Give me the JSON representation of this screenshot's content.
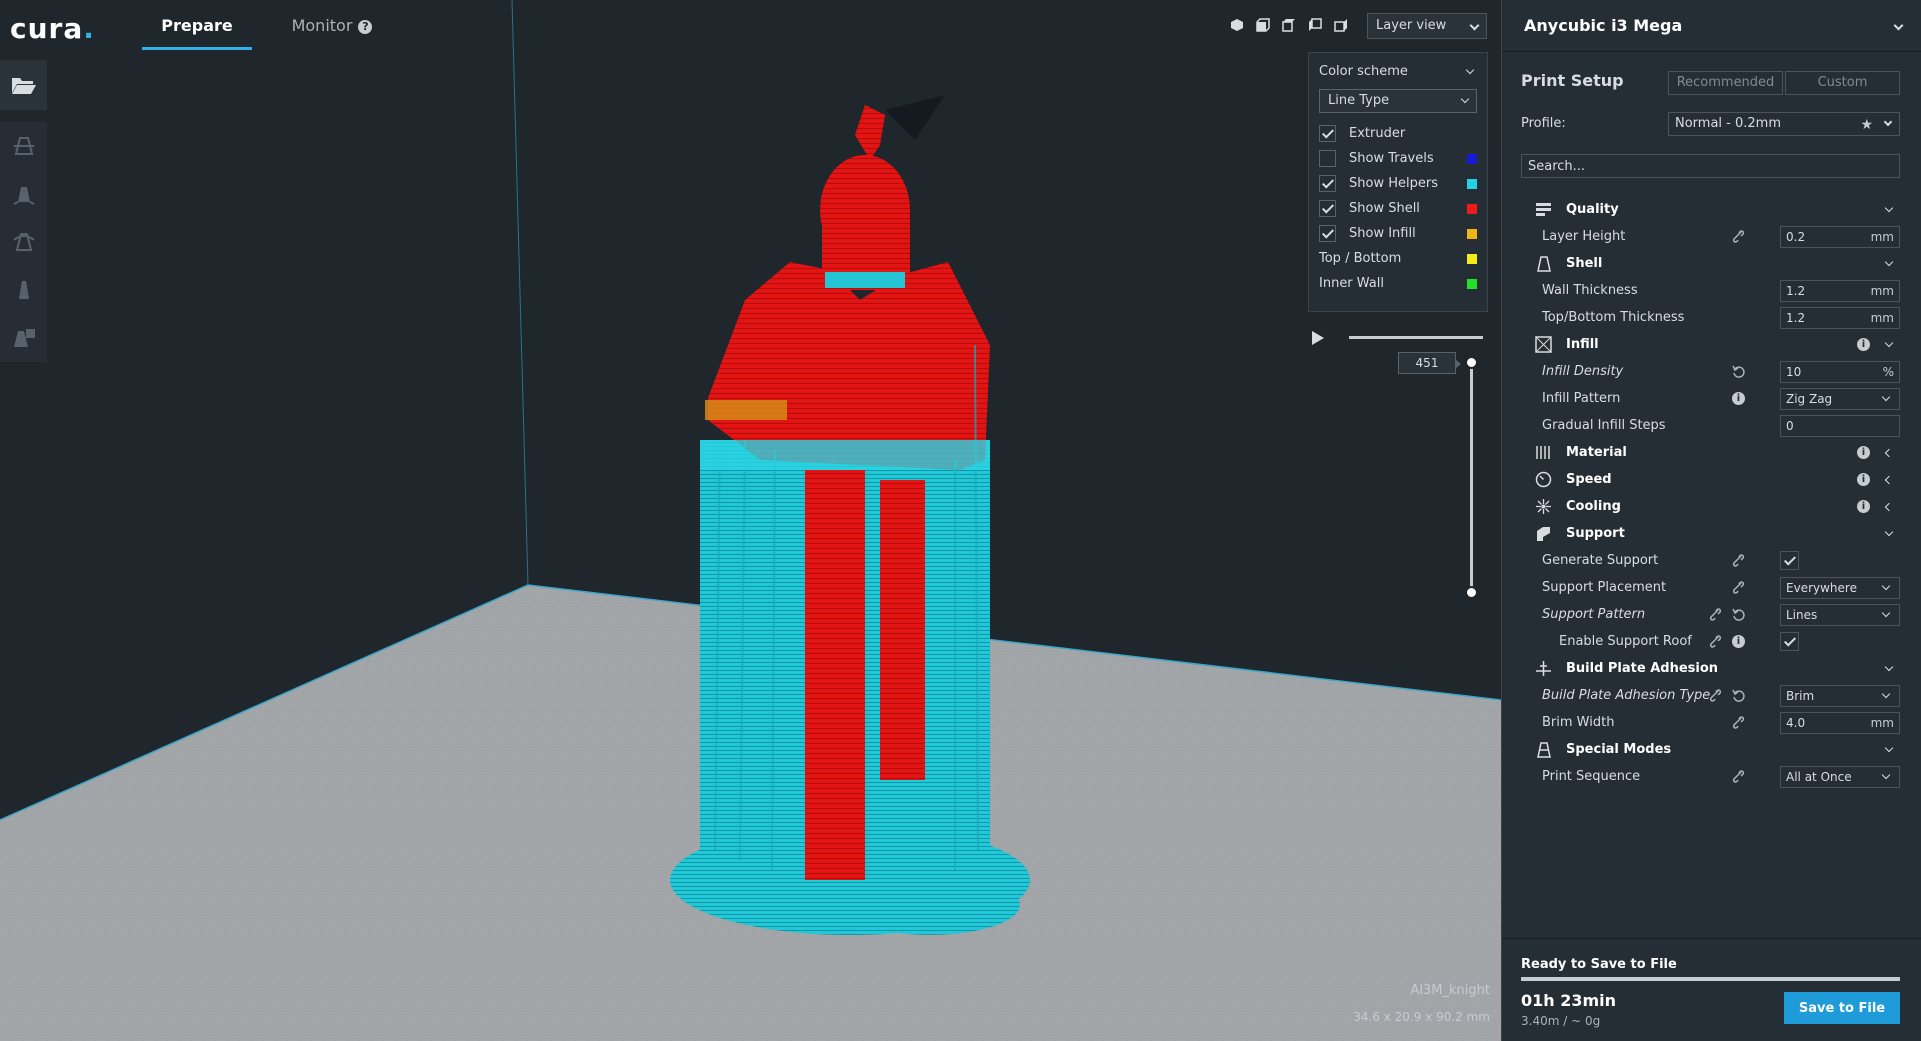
{
  "app": {
    "logo": "cura",
    "tabs": {
      "prepare": "Prepare",
      "monitor": "Monitor"
    }
  },
  "viewport": {
    "view_mode": "Layer view",
    "view_icons": [
      "3d-view-icon",
      "front-view-icon",
      "top-view-icon",
      "left-view-icon",
      "right-view-icon"
    ],
    "model_name": "AI3M_knight",
    "model_dims": "34.6 x 20.9 x 90.2 mm"
  },
  "color_scheme": {
    "title": "Color scheme",
    "selected": "Line Type",
    "items": [
      {
        "label": "Extruder",
        "checkbox": true,
        "checked": true,
        "color": ""
      },
      {
        "label": "Show Travels",
        "checkbox": true,
        "checked": false,
        "color": "#1a1ad6"
      },
      {
        "label": "Show Helpers",
        "checkbox": true,
        "checked": true,
        "color": "#22d3e6"
      },
      {
        "label": "Show Shell",
        "checkbox": true,
        "checked": true,
        "color": "#ee1b1b"
      },
      {
        "label": "Show Infill",
        "checkbox": true,
        "checked": true,
        "color": "#f2b515"
      },
      {
        "label": "Top / Bottom",
        "checkbox": false,
        "checked": false,
        "color": "#f3ec18"
      },
      {
        "label": "Inner Wall",
        "checkbox": false,
        "checked": false,
        "color": "#25e02a"
      }
    ]
  },
  "layer": {
    "current": "451",
    "top_level": 1.0,
    "bottom_level": 0.0
  },
  "sidebar": {
    "machine": "Anycubic i3 Mega",
    "print_setup": "Print Setup",
    "mode_tabs": [
      "Recommended",
      "Custom"
    ],
    "profile_label": "Profile:",
    "profile_value": "Normal - 0.2mm",
    "search_placeholder": "Search...",
    "settings": {
      "quality": "Quality",
      "layer_height": {
        "label": "Layer Height",
        "value": "0.2",
        "unit": "mm"
      },
      "shell": "Shell",
      "wall_thickness": {
        "label": "Wall Thickness",
        "value": "1.2",
        "unit": "mm"
      },
      "top_bottom_thickness": {
        "label": "Top/Bottom Thickness",
        "value": "1.2",
        "unit": "mm"
      },
      "infill": "Infill",
      "infill_density": {
        "label": "Infill Density",
        "value": "10",
        "unit": "%"
      },
      "infill_pattern": {
        "label": "Infill Pattern",
        "value": "Zig Zag"
      },
      "gradual_infill": {
        "label": "Gradual Infill Steps",
        "value": "0"
      },
      "material": "Material",
      "speed": "Speed",
      "cooling": "Cooling",
      "support": "Support",
      "generate_support": {
        "label": "Generate Support"
      },
      "support_placement": {
        "label": "Support Placement",
        "value": "Everywhere"
      },
      "support_pattern": {
        "label": "Support Pattern",
        "value": "Lines"
      },
      "support_roof": {
        "label": "Enable Support Roof"
      },
      "adhesion": "Build Plate Adhesion",
      "adhesion_type": {
        "label": "Build Plate Adhesion Type",
        "value": "Brim"
      },
      "brim_width": {
        "label": "Brim Width",
        "value": "4.0",
        "unit": "mm"
      },
      "special_modes": "Special Modes",
      "print_sequence": {
        "label": "Print Sequence",
        "value": "All at Once"
      }
    },
    "save": {
      "status": "Ready to Save to File",
      "time": "01h 23min",
      "usage": "3.40m / ~ 0g",
      "button": "Save to File"
    }
  }
}
